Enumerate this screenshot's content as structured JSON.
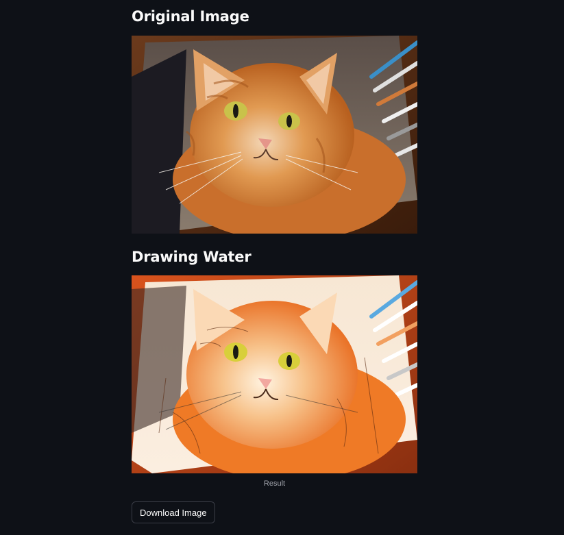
{
  "sections": {
    "original": {
      "title": "Original Image"
    },
    "drawing": {
      "title": "Drawing Water",
      "caption": "Result"
    }
  },
  "actions": {
    "download_label": "Download Image"
  },
  "colors": {
    "background": "#0e1117",
    "text": "#fafafa",
    "caption": "#a0a3ab",
    "button_border": "#3b3e47"
  }
}
